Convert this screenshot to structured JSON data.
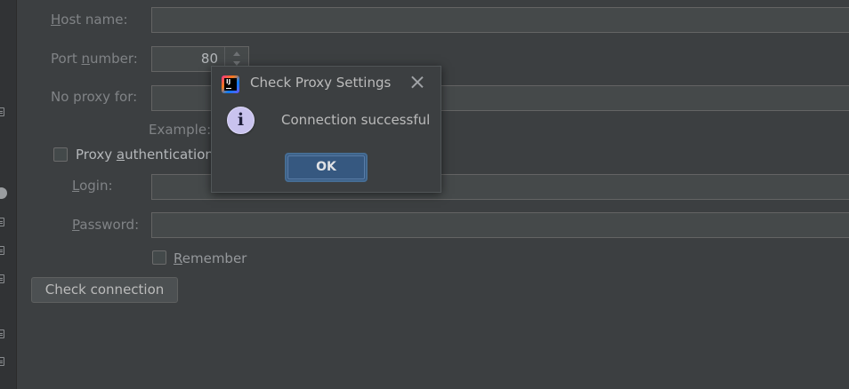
{
  "form": {
    "host_label_u": "H",
    "host_label_rest": "ost name:",
    "host_value": "",
    "port_label_pre": "Port ",
    "port_label_u": "n",
    "port_label_rest": "umber:",
    "port_value": "80",
    "no_proxy_label": "No proxy for:",
    "no_proxy_value": "",
    "example_label": "Example:",
    "proxy_auth_pre": "Proxy ",
    "proxy_auth_u": "a",
    "proxy_auth_rest": "uthentication",
    "login_label_u": "L",
    "login_label_rest": "ogin:",
    "login_value": "",
    "password_label_u": "P",
    "password_label_rest": "assword:",
    "password_value": "",
    "remember_u": "R",
    "remember_rest": "emember",
    "check_connection_label": "Check connection"
  },
  "dialog": {
    "title": "Check Proxy Settings",
    "message": "Connection successful",
    "ok_label": "OK",
    "info_glyph": "i",
    "app_icon_text": "IJ"
  },
  "icons": {
    "dialog_app": "intellij-icon",
    "dialog_info": "info-icon",
    "dialog_close": "close-icon",
    "gutter": "file-icon"
  },
  "colors": {
    "background": "#3c3f41",
    "field_bg": "#45494a",
    "ok_button": "#365880",
    "info_icon": "#c9c3ee"
  }
}
